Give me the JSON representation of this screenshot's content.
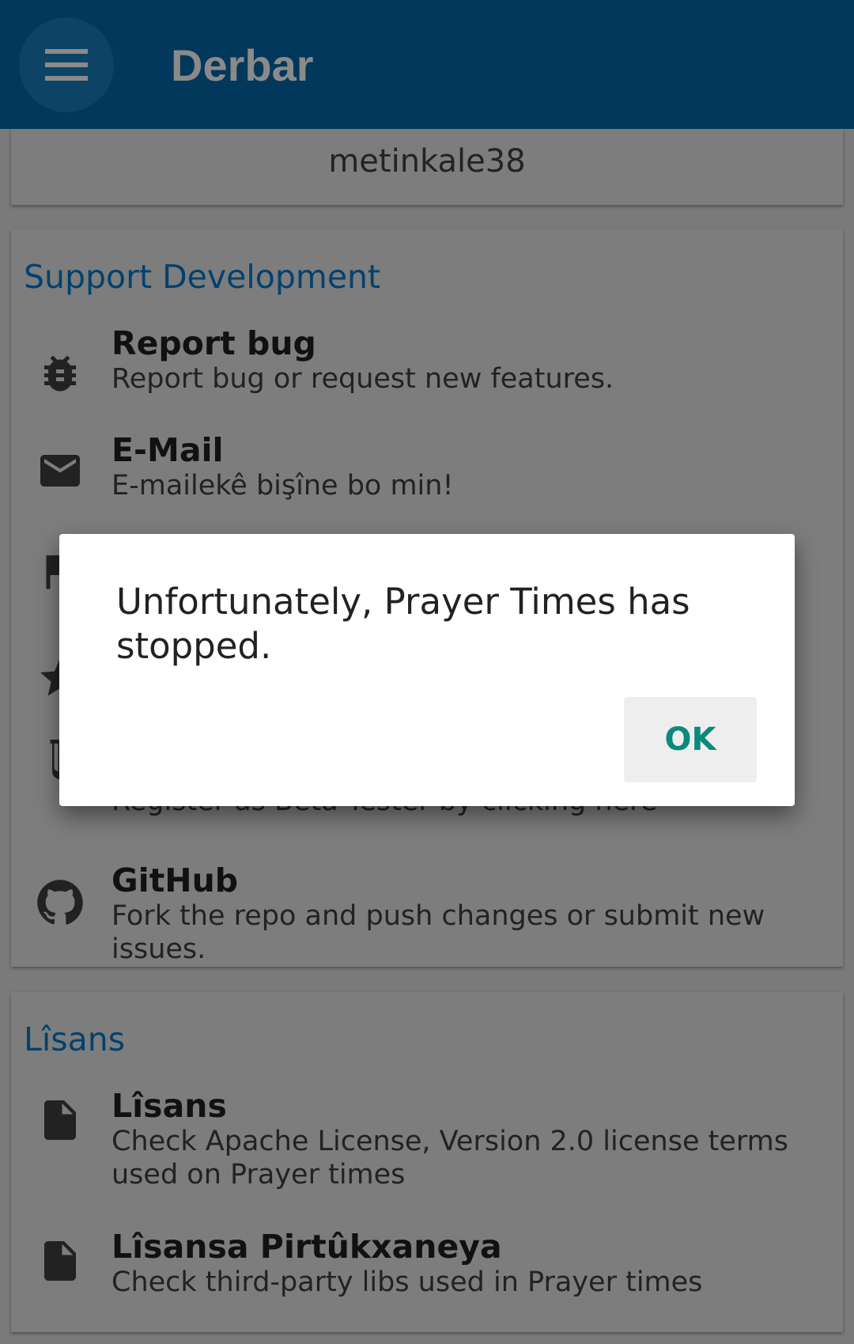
{
  "appbar": {
    "title": "Derbar"
  },
  "top_card": {
    "username": "metinkale38"
  },
  "support": {
    "title": "Support Development",
    "items": [
      {
        "title": "Report bug",
        "subtitle": "Report bug or request new features.",
        "icon": "bug-icon"
      },
      {
        "title": "E-Mail",
        "subtitle": "E-mailekê bişîne bo min!",
        "icon": "email-icon"
      },
      {
        "title": "",
        "subtitle": "",
        "icon": "flag-icon"
      },
      {
        "title": "",
        "subtitle": "",
        "icon": "star-icon"
      },
      {
        "title": "",
        "subtitle": "Register as Beta Tester by clicking here",
        "icon": "beta-icon"
      },
      {
        "title": "GitHub",
        "subtitle": "Fork the repo and push changes or submit new issues.",
        "icon": "github-icon"
      }
    ]
  },
  "license": {
    "title": "Lîsans",
    "items": [
      {
        "title": "Lîsans",
        "subtitle": "Check Apache License, Version 2.0 license terms used on Prayer times",
        "icon": "file-icon"
      },
      {
        "title": "Lîsansa Pirtûkxaneya",
        "subtitle": "Check third-party libs used in Prayer times",
        "icon": "file-icon"
      }
    ]
  },
  "dialog": {
    "message": "Unfortunately, Prayer Times has stopped.",
    "ok_label": "OK"
  },
  "colors": {
    "appbar": "#01385b",
    "section_title": "#02416e",
    "ok_text": "#0a8a7a",
    "scrim_background": "#7a7a7a"
  }
}
